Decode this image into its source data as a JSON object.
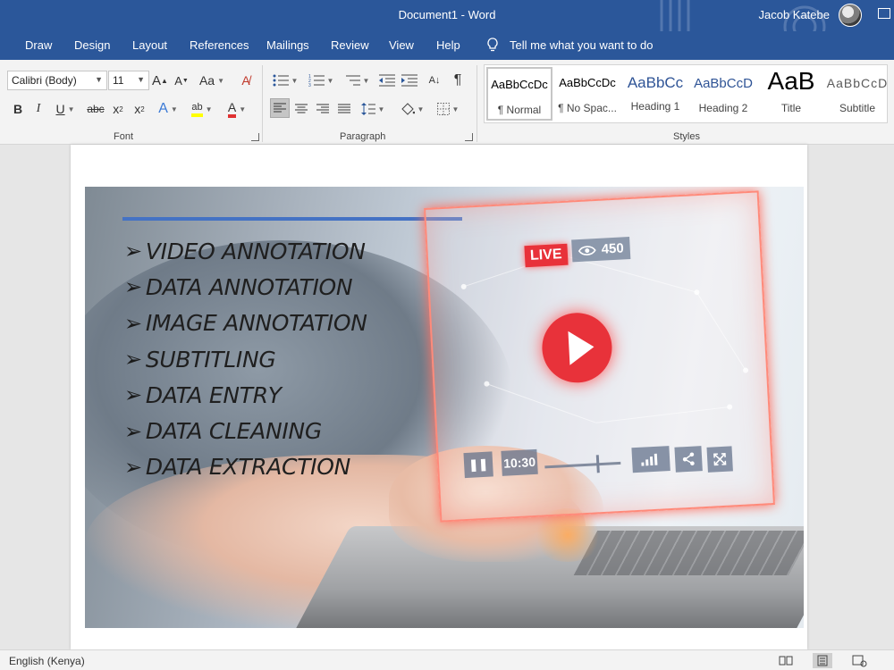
{
  "titlebar": {
    "document_title": "Document1  -  Word",
    "user_name": "Jacob Katebe"
  },
  "tabs": [
    {
      "label": "Draw"
    },
    {
      "label": "Design"
    },
    {
      "label": "Layout"
    },
    {
      "label": "References"
    },
    {
      "label": "Mailings"
    },
    {
      "label": "Review"
    },
    {
      "label": "View"
    },
    {
      "label": "Help"
    }
  ],
  "tell_me": {
    "placeholder": "Tell me what you want to do"
  },
  "font_group": {
    "label": "Font",
    "font_name": "Calibri (Body)",
    "font_size": "11",
    "grow_glyph": "A",
    "shrink_glyph": "A",
    "change_case_glyph": "Aa",
    "bold": "B",
    "italic": "I",
    "underline": "U",
    "strikethrough": "abc",
    "subscript": "x",
    "superscript": "x",
    "sub_mark": "2",
    "sup_mark": "2",
    "text_effects_glyph": "A",
    "highlight_glyph": "ab",
    "font_color_glyph": "A",
    "highlight_color": "#ffff00",
    "font_color": "#e03131"
  },
  "paragraph_group": {
    "label": "Paragraph",
    "pilcrow": "¶"
  },
  "styles_group": {
    "label": "Styles",
    "items": [
      {
        "sample": "AaBbCcDc",
        "name": "¶ Normal",
        "selected": true
      },
      {
        "sample": "AaBbCcDc",
        "name": "¶ No Spac..."
      },
      {
        "sample": "AaBbCc",
        "name": "Heading 1"
      },
      {
        "sample": "AaBbCcD",
        "name": "Heading 2"
      },
      {
        "sample": "AaB",
        "name": "Title"
      },
      {
        "sample": "AaBbCcD",
        "name": "Subtitle"
      }
    ]
  },
  "document": {
    "services": [
      {
        "bullet": "➢",
        "text": "VIDEO ANNOTATION"
      },
      {
        "bullet": "➢",
        "text": "DATA ANNOTATION"
      },
      {
        "bullet": "➢",
        "text": "IMAGE ANNOTATION"
      },
      {
        "bullet": "➢",
        "text": "SUBTITLING"
      },
      {
        "bullet": "➢",
        "text": "DATA ENTRY"
      },
      {
        "bullet": "➢",
        "text": "DATA CLEANING"
      },
      {
        "bullet": "➢",
        "text": "DATA EXTRACTION"
      }
    ],
    "player": {
      "live_badge": "LIVE",
      "view_count": "450",
      "timestamp": "10:30",
      "pause_glyph": "❚❚"
    },
    "accent_colors": {
      "rule": "#4472c4",
      "live": "#e8323a"
    }
  },
  "statusbar": {
    "language": "English (Kenya)"
  },
  "colors": {
    "word_blue": "#2b579a",
    "ribbon_bg": "#f3f3f3"
  }
}
